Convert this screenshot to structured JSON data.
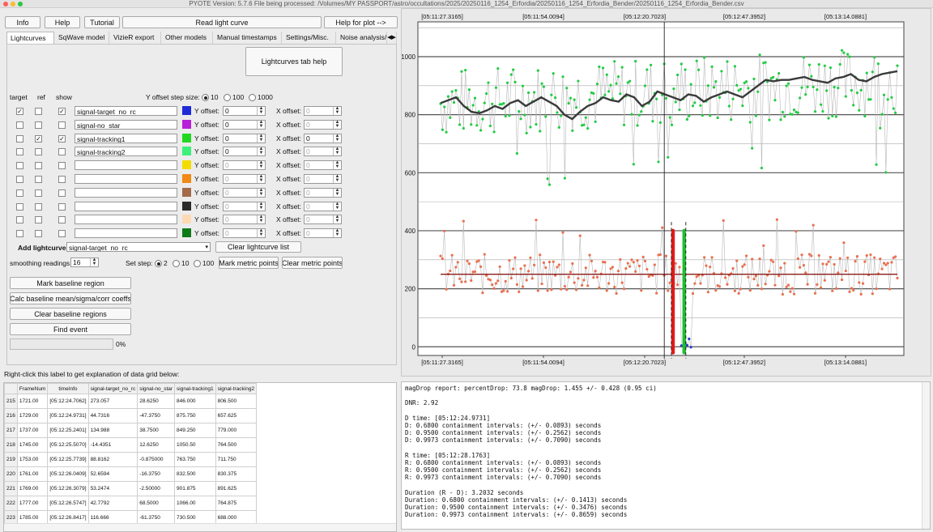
{
  "window_title": "PYOTE Version: 5.7.6  File being processed: /Volumes/MY PASSPORT/astro/occultations/2025/20250116_1254_Erfordia/20250116_1254_Erfordia_Bender/20250116_1254_Erfordia_Bender.csv",
  "toolbar": {
    "info": "Info",
    "help": "Help",
    "tutorial": "Tutorial",
    "read_lightcurve": "Read light curve",
    "help_for_plot": "Help for plot -->"
  },
  "tabs": [
    "Lightcurves",
    "SqWave model",
    "VizieR export",
    "Other models",
    "Manual timestamps",
    "Settings/Misc.",
    "Noise analysis/"
  ],
  "lightcurves_help": "Lightcurves tab help",
  "headers": {
    "target": "target",
    "ref": "ref",
    "show": "show",
    "y_offset_step": "Y offset step size:"
  },
  "step_options": [
    "10",
    "100",
    "1000"
  ],
  "y_offset_label": "Y offset:",
  "x_offset_label": "X offset:",
  "rows": [
    {
      "name": "signal-target_no_rc",
      "color": "#1f2bd8",
      "target": true,
      "ref": false,
      "show": true,
      "y": "0",
      "x": "0",
      "x_active": false
    },
    {
      "name": "signal-no_star",
      "color": "#b81fd9",
      "target": false,
      "ref": false,
      "show": false,
      "y": "0",
      "x": "0",
      "x_active": false
    },
    {
      "name": "signal-tracking1",
      "color": "#22d81f",
      "target": false,
      "ref": true,
      "show": true,
      "y": "0",
      "x": "0",
      "x_active": true
    },
    {
      "name": "signal-tracking2",
      "color": "#3cf07a",
      "target": false,
      "ref": false,
      "show": false,
      "y": "0",
      "x": "0",
      "x_active": false
    },
    {
      "name": "",
      "color": "#f4dc00",
      "target": false,
      "ref": false,
      "show": false,
      "y": "0",
      "x": "0",
      "x_active": false
    },
    {
      "name": "",
      "color": "#f08a14",
      "target": false,
      "ref": false,
      "show": false,
      "y": "0",
      "x": "0",
      "x_active": false
    },
    {
      "name": "",
      "color": "#a26a48",
      "target": false,
      "ref": false,
      "show": false,
      "y": "0",
      "x": "0",
      "x_active": false
    },
    {
      "name": "",
      "color": "#2b2b2b",
      "target": false,
      "ref": false,
      "show": false,
      "y": "0",
      "x": "0",
      "x_active": false
    },
    {
      "name": "",
      "color": "#ffd9b3",
      "target": false,
      "ref": false,
      "show": false,
      "y": "0",
      "x": "0",
      "x_active": false
    },
    {
      "name": "",
      "color": "#0d7a17",
      "target": false,
      "ref": false,
      "show": false,
      "y": "0",
      "x": "0",
      "x_active": false
    }
  ],
  "add_lightcurve_label": "Add lightcurve",
  "add_lightcurve_value": "signal-target_no_rc",
  "clear_lightcurve_list": "Clear lightcurve list",
  "smoothing_label": "smoothing readings",
  "smoothing_value": "16",
  "set_step_label": "Set step:",
  "set_step_options": [
    "2",
    "10",
    "100"
  ],
  "mark_metric": "Mark metric points",
  "clear_metric": "Clear metric points",
  "mark_baseline": "Mark baseline region",
  "calc_baseline": "Calc baseline mean/sigma/corr coeffs",
  "clear_baseline": "Clear baseline regions",
  "find_event": "Find event",
  "progress": "0%",
  "right_click_hint": "Right-click this label to get explanation of data grid below:",
  "grid": {
    "columns": [
      "FrameNum",
      "timeInfo",
      "signal-target_no_rc",
      "signal-no_star",
      "signal-tracking1",
      "signal-tracking2"
    ],
    "rows": [
      [
        "215",
        "1721.00",
        "[05:12:24.7062]",
        "273.057",
        "28.6250",
        "846.000",
        "806.500"
      ],
      [
        "216",
        "1729.00",
        "[05:12:24.9731]",
        "44.7316",
        "-47.3750",
        "875.750",
        "657.625"
      ],
      [
        "217",
        "1737.00",
        "[05:12:25.2401]",
        "134.988",
        "38.7500",
        "849.250",
        "779.000"
      ],
      [
        "218",
        "1745.00",
        "[05:12:25.5070]",
        "-14.4351",
        "12.6250",
        "1050.50",
        "764.500"
      ],
      [
        "219",
        "1753.00",
        "[05:12:25.7739]",
        "88.8162",
        "-0.875000",
        "763.750",
        "711.750"
      ],
      [
        "220",
        "1761.00",
        "[05:12:26.0409]",
        "52.6594",
        "-16.3750",
        "832.500",
        "830.375"
      ],
      [
        "221",
        "1769.00",
        "[05:12:26.3079]",
        "53.2474",
        "-2.50000",
        "901.875",
        "891.625"
      ],
      [
        "222",
        "1777.00",
        "[05:12:26.5747]",
        "42.7792",
        "68.5000",
        "1066.00",
        "764.875"
      ],
      [
        "223",
        "1785.00",
        "[05:12:26.8417]",
        "116.666",
        "-61.3750",
        "730.500",
        "688.000"
      ]
    ]
  },
  "report_lines": [
    "magDrop report: percentDrop: 73.8 magDrop: 1.455 +/- 0.428 (0.95 ci)",
    "",
    "DNR: 2.92",
    "",
    "D time: [05:12:24.9731]",
    "D: 0.6800 containment intervals: (+/- 0.0893) seconds",
    "D: 0.9500 containment intervals: (+/- 0.2562) seconds",
    "D: 0.9973 containment intervals: (+/- 0.7090) seconds",
    "",
    "R time: [05:12:28.1763]",
    "R: 0.6800 containment intervals: (+/- 0.0893) seconds",
    "R: 0.9500 containment intervals: (+/- 0.2562) seconds",
    "R: 0.9973 containment intervals: (+/- 0.7090) seconds",
    "",
    "Duration (R - D): 3.2032 seconds",
    "Duration: 0.6800 containment intervals: (+/- 0.1413) seconds",
    "Duration: 0.9500 containment intervals: (+/- 0.3476) seconds",
    "Duration: 0.9973 containment intervals: (+/- 0.8659) seconds"
  ],
  "chart_data": {
    "type": "scatter",
    "title": "",
    "xlabel": "",
    "ylabel": "",
    "x_tick_labels": [
      "[05:11:27.3165]",
      "[05:11:54.0094]",
      "[05:12:20.7023]",
      "[05:12:47.3952]",
      "[05:13:14.0881]"
    ],
    "y_ticks": [
      0,
      200,
      400,
      600,
      800,
      1000
    ],
    "ylim": [
      -30,
      1120
    ],
    "series": [
      {
        "color": "#22cc44",
        "mean": 880,
        "spread": 120
      },
      {
        "color": "#e97050",
        "mean": 250,
        "spread": 70
      },
      {
        "color": "#3a3a3a",
        "values": [
          840,
          850,
          860,
          830,
          810,
          805,
          815,
          830,
          820,
          840,
          850,
          830,
          845,
          860,
          845,
          830,
          800,
          785,
          810,
          830,
          840,
          860,
          850,
          845,
          870,
          860,
          830,
          845,
          880,
          870,
          860,
          850,
          870,
          865,
          845,
          860,
          870,
          880,
          870,
          860,
          880,
          900,
          920,
          915,
          920,
          920,
          925,
          930,
          920,
          915,
          910,
          925,
          930,
          940,
          920,
          915,
          930,
          940,
          945,
          950
        ]
      },
      {
        "color": "#8b1a1a",
        "values": [
          250
        ]
      }
    ],
    "event_d_frame": 0.525,
    "event_r_frame": 0.548,
    "cursor_line": 0.507,
    "event_colors": {
      "d": "#e31a1a",
      "r": "#1fbf30",
      "blue": "#1f3fc8"
    }
  }
}
